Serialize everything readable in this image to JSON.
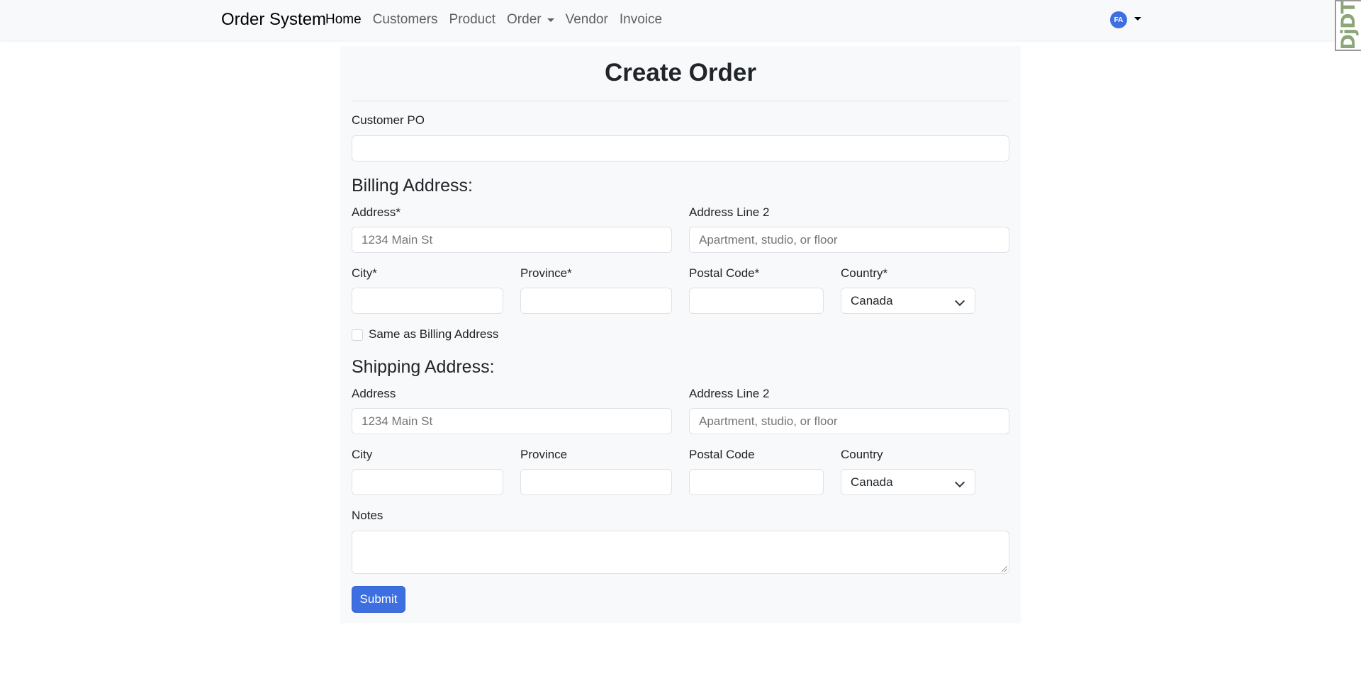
{
  "navbar": {
    "brand": "Order System",
    "items": [
      {
        "label": "Home",
        "active": true
      },
      {
        "label": "Customers"
      },
      {
        "label": "Product"
      },
      {
        "label": "Order",
        "dropdown": true
      },
      {
        "label": "Vendor"
      },
      {
        "label": "Invoice"
      }
    ],
    "user_initials": "FA",
    "debug_toolbar": "DjDT"
  },
  "form": {
    "title": "Create Order",
    "customer_po": {
      "label": "Customer PO",
      "value": ""
    },
    "billing": {
      "heading": "Billing Address:",
      "address_label": "Address*",
      "address_placeholder": "1234 Main St",
      "address2_label": "Address Line 2",
      "address2_placeholder": "Apartment, studio, or floor",
      "city_label": "City*",
      "province_label": "Province*",
      "postal_label": "Postal Code*",
      "country_label": "Country*",
      "country_value": "Canada"
    },
    "same_as_billing": {
      "label": "Same as Billing Address",
      "checked": false
    },
    "shipping": {
      "heading": "Shipping Address:",
      "address_label": "Address",
      "address_placeholder": "1234 Main St",
      "address2_label": "Address Line 2",
      "address2_placeholder": "Apartment, studio, or floor",
      "city_label": "City",
      "province_label": "Province",
      "postal_label": "Postal Code",
      "country_label": "Country",
      "country_value": "Canada"
    },
    "notes_label": "Notes",
    "submit_label": "Submit"
  },
  "colors": {
    "primary": "#3d6fe0",
    "card_background": "#f8f9fa",
    "navbar_background": "#f8f9fa"
  }
}
